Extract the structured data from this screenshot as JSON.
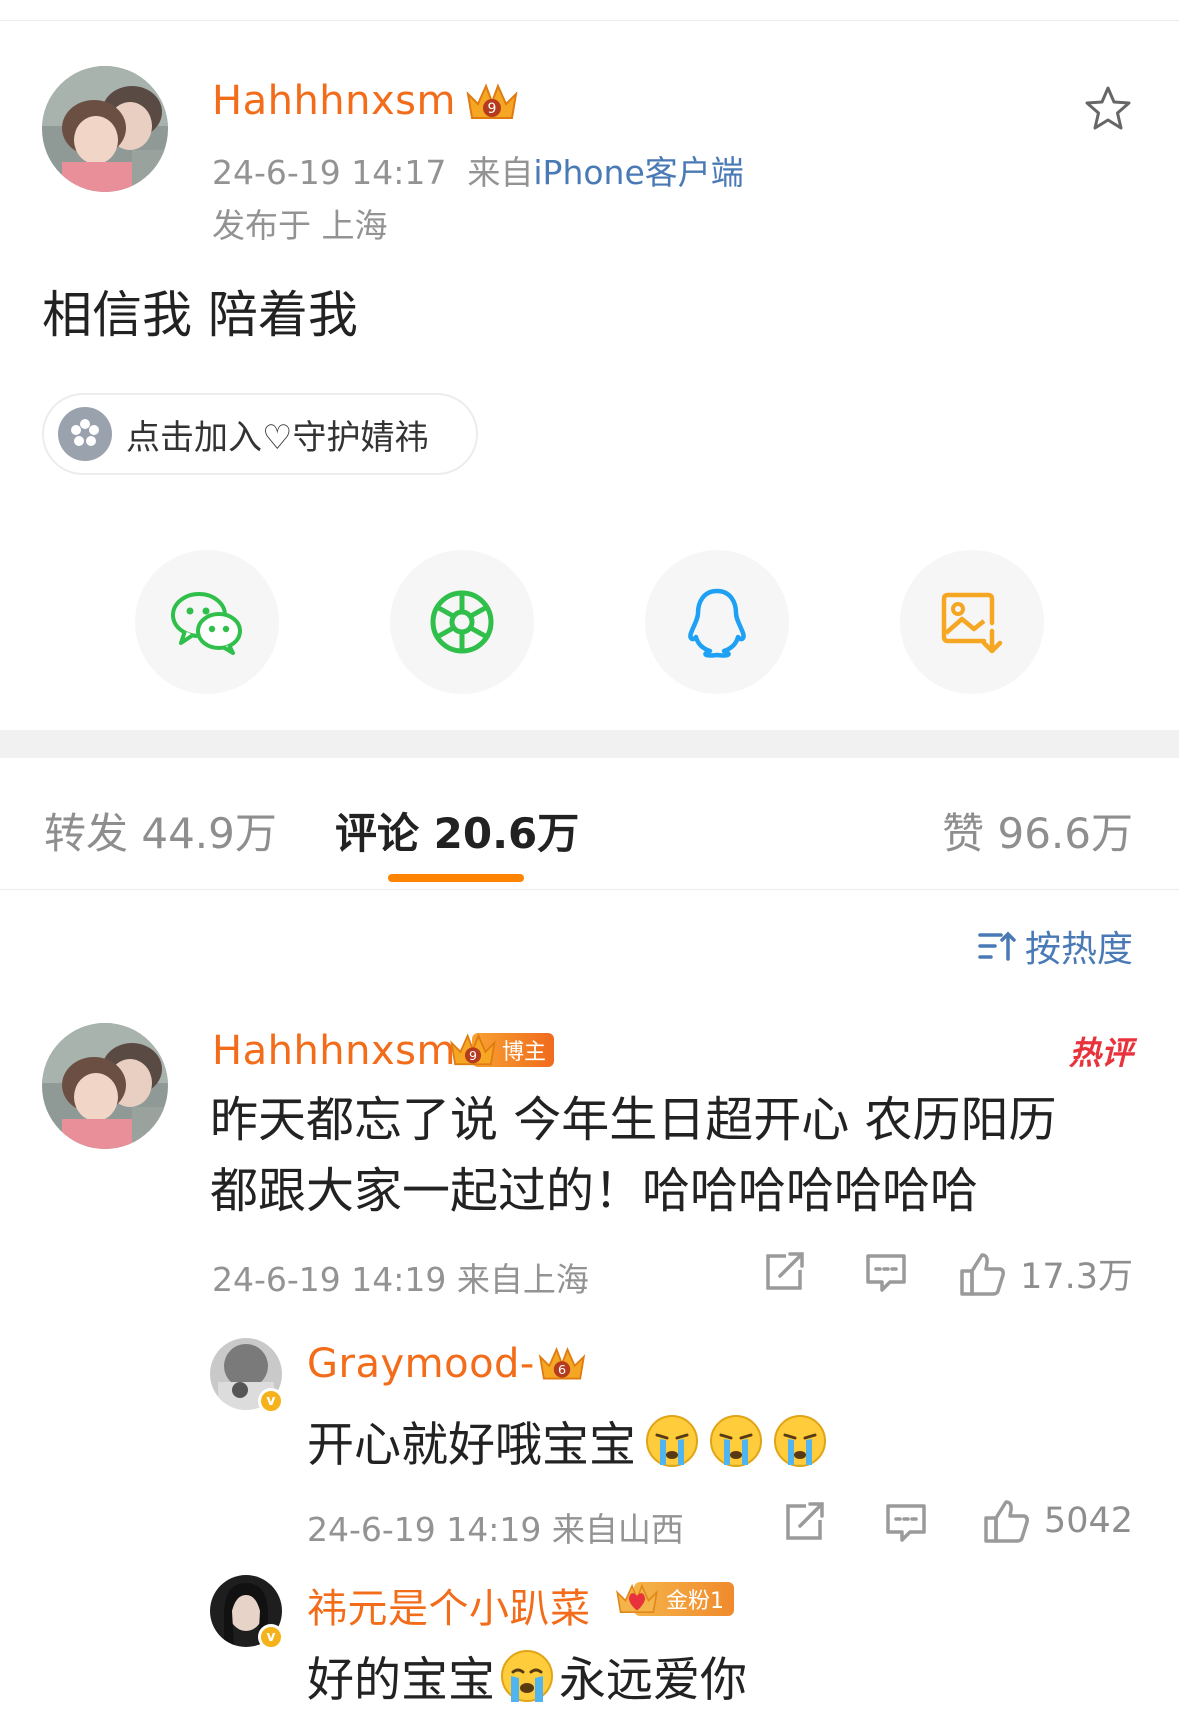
{
  "post": {
    "username": "Hahhhnxsm",
    "timestamp": "24-6-19 14:17",
    "via_prefix": "来自",
    "source": "iPhone客户端",
    "location": "发布于 上海",
    "text": "相信我 陪着我",
    "super_topic_chip": "点击加入♡守护婧祎"
  },
  "share": {
    "items": [
      {
        "name": "wechat-icon",
        "color": "#2fbf4a"
      },
      {
        "name": "moments-icon",
        "color": "#2fbf4a"
      },
      {
        "name": "qq-icon",
        "color": "#1ea0f5"
      },
      {
        "name": "save-image-icon",
        "color": "#f5a623"
      }
    ]
  },
  "tabs": {
    "repost": "转发 44.9万",
    "comments": "评论 20.6万",
    "likes": "赞 96.6万"
  },
  "sort": {
    "label": "按热度"
  },
  "comments": [
    {
      "username": "Hahhhnxsm",
      "badge": "博主",
      "hot_label": "热评",
      "text_line1": "昨天都忘了说 今年生日超开心 农历阳历",
      "text_line2": "都跟大家一起过的！哈哈哈哈哈哈哈",
      "meta": "24-6-19 14:19 来自上海",
      "like_count": "17.3万"
    },
    {
      "username": "Graymood-",
      "text": "开心就好哦宝宝",
      "meta": "24-6-19 14:19 来自山西",
      "like_count": "5042"
    },
    {
      "username": "祎元是个小趴菜",
      "badge": "金粉1",
      "text_before": "好的宝宝",
      "text_after": "永远爱你"
    }
  ],
  "colors": {
    "username": "#f26c1a",
    "link": "#4a7ab5",
    "accent": "#ff8200",
    "hot": "#e8333c"
  }
}
